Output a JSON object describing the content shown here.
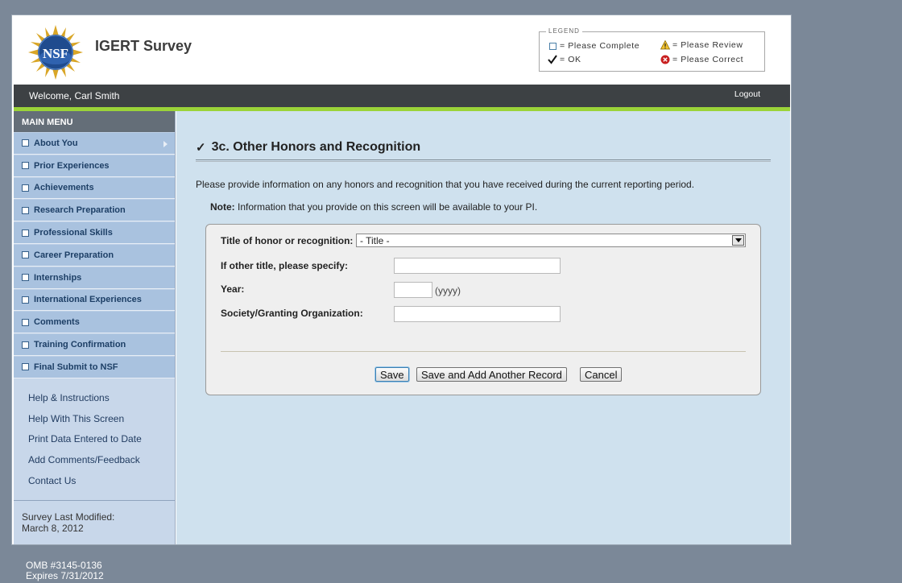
{
  "header": {
    "logo_text": "NSF",
    "app_title": "IGERT Survey"
  },
  "legend": {
    "title": "LEGEND",
    "please_complete": "= Please Complete",
    "please_review": "= Please Review",
    "ok": "= OK",
    "please_correct": "= Please Correct"
  },
  "topbar": {
    "welcome": "Welcome, Carl Smith",
    "logout": "Logout"
  },
  "sidebar": {
    "menu_title": "MAIN MENU",
    "items": [
      {
        "label": "About You"
      },
      {
        "label": "Prior Experiences"
      },
      {
        "label": "Achievements"
      },
      {
        "label": "Research Preparation"
      },
      {
        "label": "Professional Skills"
      },
      {
        "label": "Career Preparation"
      },
      {
        "label": "Internships"
      },
      {
        "label": "International Experiences"
      },
      {
        "label": "Comments"
      },
      {
        "label": "Training Confirmation"
      },
      {
        "label": "Final Submit to NSF"
      }
    ],
    "links": [
      {
        "label": "Help & Instructions"
      },
      {
        "label": "Help With This Screen"
      },
      {
        "label": "Print Data Entered to Date"
      },
      {
        "label": "Add Comments/Feedback"
      },
      {
        "label": "Contact Us"
      }
    ],
    "modified_label": "Survey Last Modified:",
    "modified_date": "March 8, 2012"
  },
  "main": {
    "check_mark": "✓",
    "page_title": "3c. Other Honors and Recognition",
    "intro": "Please provide information on any honors and recognition that you have received during the current reporting period.",
    "note_label": "Note:",
    "note_text": " Information that you provide on this screen will be available to your PI."
  },
  "form": {
    "title_label": "Title of honor or recognition:",
    "title_selected": "- Title -",
    "other_title_label": "If other title, please specify:",
    "other_title_value": "",
    "year_label": "Year:",
    "year_value": "",
    "year_hint": "(yyyy)",
    "society_label": "Society/Granting Organization:",
    "society_value": "",
    "save_label": "Save",
    "save_add_label": "Save and Add Another Record",
    "cancel_label": "Cancel"
  },
  "footer": {
    "omb": "OMB #3145-0136",
    "expires": "Expires 7/31/2012"
  },
  "colors": {
    "sidebar_item": "#a9c2df",
    "topbar": "#3d4144",
    "accent_green": "#9bd339",
    "main_bg": "#cfe1ee"
  }
}
